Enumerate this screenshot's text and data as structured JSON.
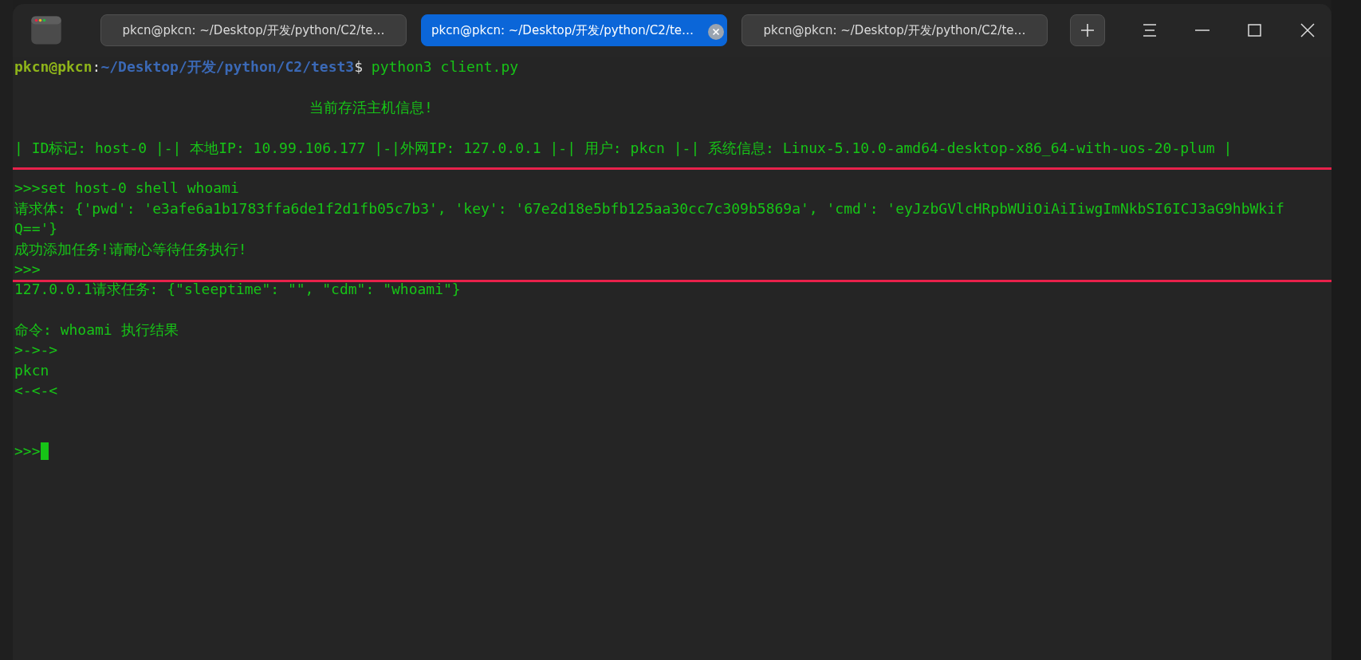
{
  "window": {
    "tabs": [
      {
        "label": "pkcn@pkcn: ~/Desktop/开发/python/C2/te…",
        "selected": false
      },
      {
        "label": "pkcn@pkcn: ~/Desktop/开发/python/C2/te…",
        "selected": true
      },
      {
        "label": "pkcn@pkcn: ~/Desktop/开发/python/C2/te…",
        "selected": false
      }
    ]
  },
  "terminal": {
    "lines": [
      {
        "kind": "prompt",
        "user": "pkcn@pkcn",
        "sep": ":",
        "path": "~/Desktop/开发/python/C2/test3",
        "symbol": "$",
        "command": "python3 client.py"
      },
      {
        "kind": "blank"
      },
      {
        "kind": "heading",
        "text": "当前存活主机信息!"
      },
      {
        "kind": "blank"
      },
      {
        "kind": "output",
        "text": "| ID标记: host-0 |-| 本地IP: 10.99.106.177 |-|外网IP: 127.0.0.1 |-| 用户: pkcn |-| 系统信息: Linux-5.10.0-amd64-desktop-x86_64-with-uos-20-plum |"
      },
      {
        "kind": "blank"
      },
      {
        "kind": "output",
        "text": ">>>set host-0 shell whoami",
        "highlighted": true
      },
      {
        "kind": "output",
        "text": "请求体: {'pwd': 'e3afe6a1b1783ffa6de1f2d1fb05c7b3', 'key': '67e2d18e5bfb125aa30cc7c309b5869a', 'cmd': 'eyJzbGVlcHRpbWUiOiAiIiwgImNkbSI6ICJ3aG9hbWkif",
        "highlighted": true
      },
      {
        "kind": "output",
        "text": "Q=='}",
        "highlighted": true
      },
      {
        "kind": "output",
        "text": "成功添加任务!请耐心等待任务执行!",
        "highlighted": true
      },
      {
        "kind": "output",
        "text": ">>>",
        "highlighted": true
      },
      {
        "kind": "output",
        "text": "127.0.0.1请求任务: {\"sleeptime\": \"\", \"cdm\": \"whoami\"}"
      },
      {
        "kind": "blank"
      },
      {
        "kind": "output",
        "text": "命令: whoami 执行结果"
      },
      {
        "kind": "output",
        "text": ">->->"
      },
      {
        "kind": "output",
        "text": "pkcn"
      },
      {
        "kind": "output",
        "text": "<-<-<"
      },
      {
        "kind": "blank"
      },
      {
        "kind": "blank"
      },
      {
        "kind": "input",
        "text": ">>>"
      }
    ]
  }
}
